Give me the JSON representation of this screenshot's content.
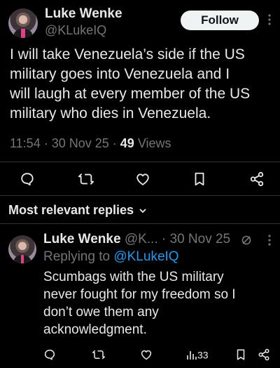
{
  "post": {
    "author_name": "Luke Wenke",
    "author_handle": "@KLukeIQ",
    "follow_label": "Follow",
    "text_lines": [
      "I will take Venezuela’s side if the US",
      "military goes into Venezuela and I",
      "will laugh at every member of the US",
      "military who dies in Venezuela."
    ],
    "time": "11:54",
    "date": "30 Nov 25",
    "views_count": "49",
    "views_label": "Views"
  },
  "replies_section": {
    "label": "Most relevant replies"
  },
  "reply": {
    "author_name": "Luke Wenke",
    "handle_truncated": "@K...",
    "date": "30 Nov 25",
    "replying_prefix": "Replying to",
    "replying_handle": "@KLukeIQ",
    "text_lines": [
      "Scumbags with the US military",
      "never fought for my freedom so I",
      "don’t owe them any",
      "acknowledgment."
    ],
    "views_count": "33"
  },
  "colors": {
    "background": "#000000",
    "text": "#e7e9ea",
    "muted": "#71767b",
    "link": "#1d9bf0",
    "divider": "#2f3336"
  },
  "icons": [
    "reply-icon",
    "retweet-icon",
    "like-icon",
    "bookmark-icon",
    "share-icon",
    "views-icon",
    "grok-icon",
    "more-icon",
    "chevron-down-icon"
  ]
}
